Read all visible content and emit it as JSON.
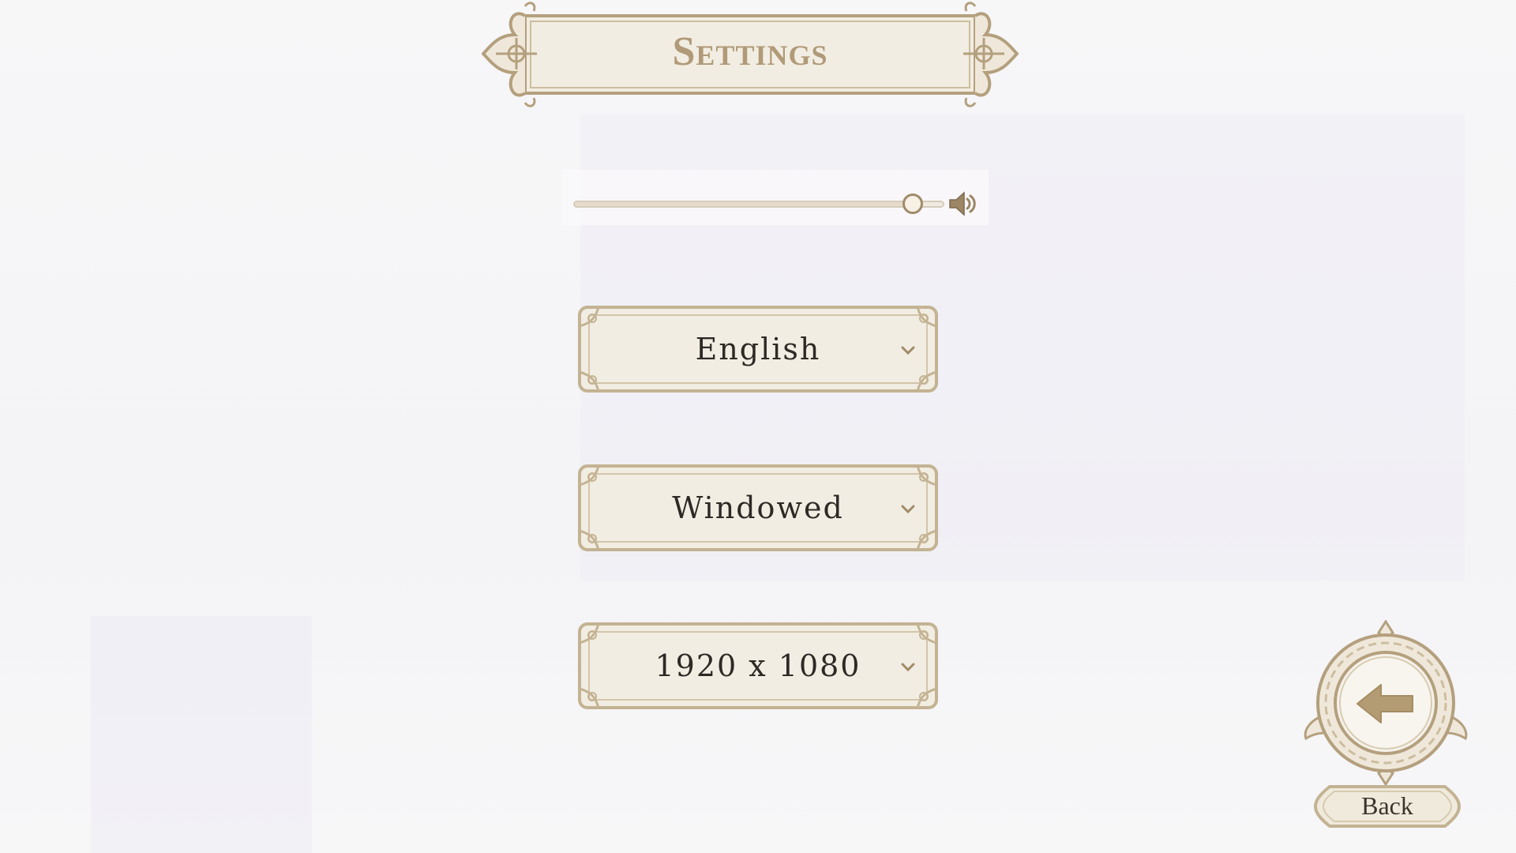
{
  "title": "Settings",
  "volume": {
    "level": 0.915,
    "icon": "speaker-icon"
  },
  "dropdowns": [
    {
      "id": "language",
      "value": "English"
    },
    {
      "id": "display-mode",
      "value": "Windowed"
    },
    {
      "id": "resolution",
      "value": "1920 x 1080"
    }
  ],
  "back": {
    "label": "Back",
    "icon": "back-arrow-icon"
  },
  "colors": {
    "ornament": "#b4a07e",
    "panel_fill": "#f1ece1",
    "text": "#2d2a26",
    "title": "#b09a78",
    "arrow": "#b39b73"
  }
}
